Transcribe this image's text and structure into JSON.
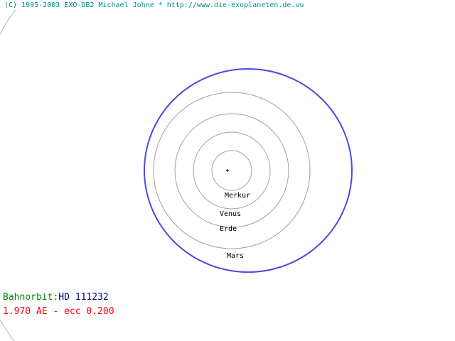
{
  "copyright": "(C) 1995-2003 EXO-DB2 Michael Johne * http://www.die-exoplaneten.de.vu",
  "planets": [
    {
      "name": "Merkur",
      "label": "Merkur"
    },
    {
      "name": "Venus",
      "label": "Venus"
    },
    {
      "name": "Erde",
      "label": "Erde"
    },
    {
      "name": "Mars",
      "label": "Mars"
    }
  ],
  "orbit": {
    "label": "Bahnorbit:",
    "star": "HD 111232",
    "params": "1.970 AE - ecc 0.200"
  },
  "colors": {
    "copyright": "#008b8b",
    "bahn_label": "#008000",
    "star": "#000080",
    "params": "#ff0000",
    "exo_orbit": "#4a4ae0",
    "planet_orbit": "#a0a0a0",
    "arc": "#b8b8b8"
  }
}
